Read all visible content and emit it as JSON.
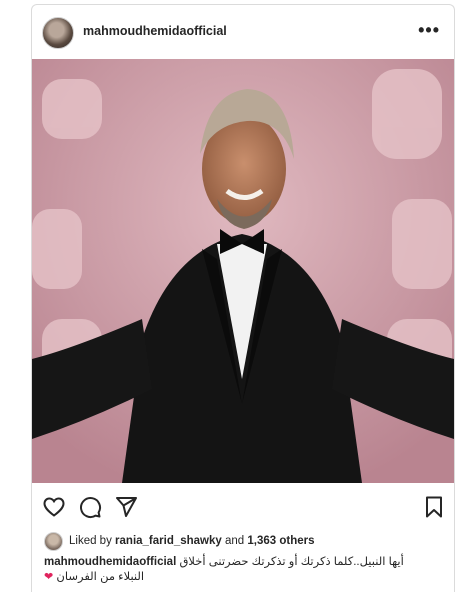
{
  "post": {
    "username": "mahmoudhemidaofficial",
    "more_label": "•••",
    "liked_prefix": "Liked by",
    "liked_user": "rania_farid_shawky",
    "liked_and": "and",
    "liked_count": "1,363 others",
    "caption_user": "mahmoudhemidaofficial",
    "caption_text": "أيها النبيل..كلما ذكرتك أو تذكرتك حضرتنى أخلاق",
    "caption_text2": "النبلاء من الفرسان",
    "caption_emoji": "❤"
  },
  "icons": [
    "heart-icon",
    "comment-icon",
    "share-icon",
    "bookmark-icon",
    "more-icon"
  ],
  "colors": {
    "photo_bg": "#c99aa6",
    "text": "#262626",
    "border": "#dbdbdb",
    "heart_emoji": "#e0245e"
  }
}
